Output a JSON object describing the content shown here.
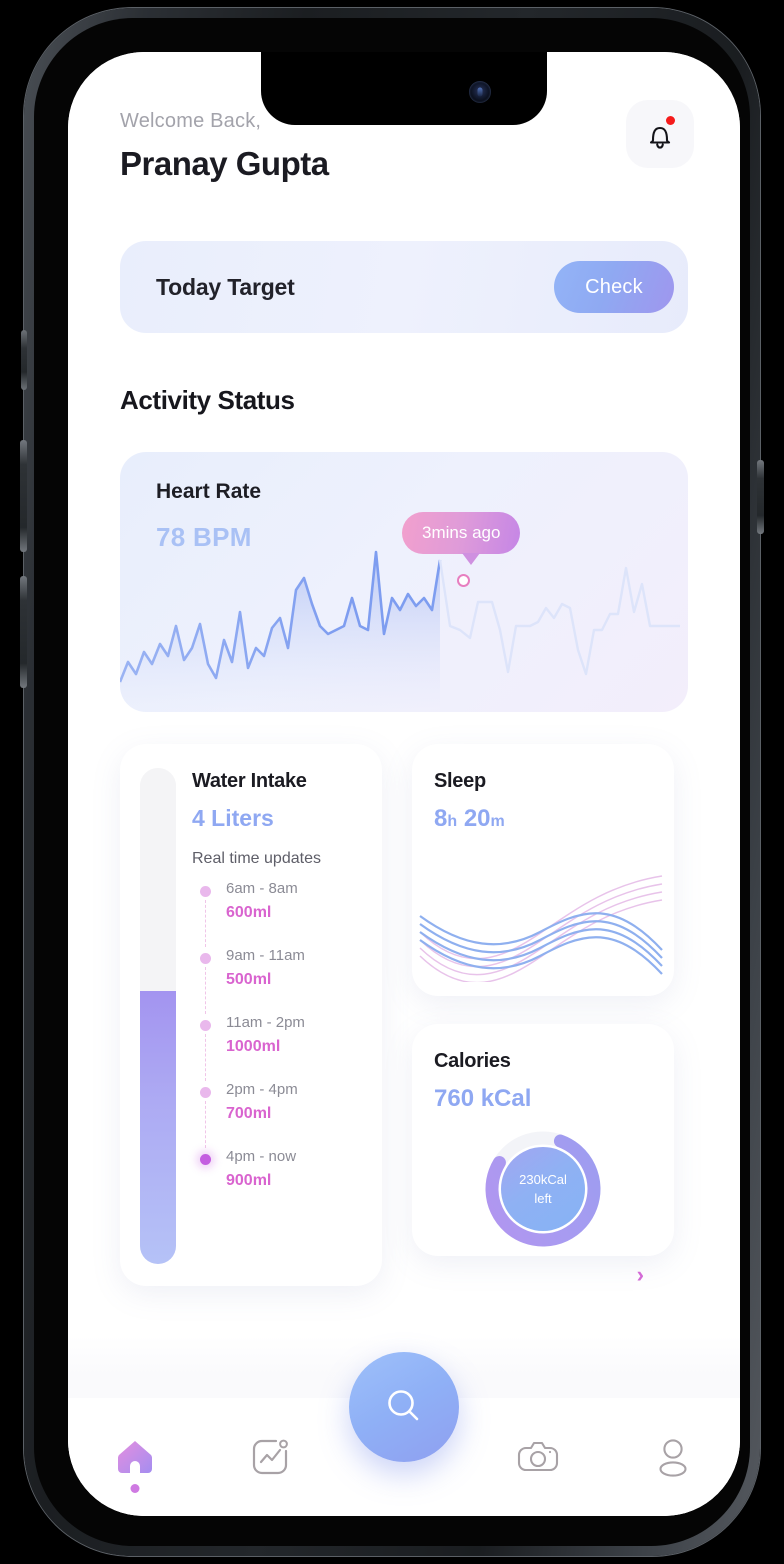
{
  "header": {
    "welcome": "Welcome Back,",
    "username": "Pranay Gupta",
    "bell_icon": "bell-icon"
  },
  "today_target": {
    "label": "Today Target",
    "button": "Check"
  },
  "section": {
    "activity_status": "Activity Status"
  },
  "heart_rate": {
    "title": "Heart Rate",
    "value": "78 BPM",
    "tooltip": "3mins ago"
  },
  "water": {
    "title": "Water Intake",
    "value": "4 Liters",
    "subtitle": "Real time updates",
    "fill_percent": 55,
    "updates": [
      {
        "time": "6am - 8am",
        "amount": "600ml",
        "active": false
      },
      {
        "time": "9am - 11am",
        "amount": "500ml",
        "active": false
      },
      {
        "time": "11am - 2pm",
        "amount": "1000ml",
        "active": false
      },
      {
        "time": "2pm - 4pm",
        "amount": "700ml",
        "active": false
      },
      {
        "time": "4pm - now",
        "amount": "900ml",
        "active": true
      }
    ]
  },
  "sleep": {
    "title": "Sleep",
    "hours": "8",
    "hours_unit": "h",
    "minutes": "20",
    "minutes_unit": "m"
  },
  "calories": {
    "title": "Calories",
    "value": "760 kCal",
    "ring_line1": "230kCal",
    "ring_line2": "left",
    "chevron": "›"
  },
  "tabbar": {
    "items": [
      {
        "name": "home-icon",
        "active": true
      },
      {
        "name": "activity-icon",
        "active": false
      },
      {
        "name": "search-icon",
        "active": false
      },
      {
        "name": "camera-icon",
        "active": false
      },
      {
        "name": "profile-icon",
        "active": false
      }
    ]
  },
  "colors": {
    "accent_blue": "#8fa8f2",
    "accent_purple": "#9f96ee",
    "accent_pink": "#d964cf",
    "text_dark": "#1b1b22",
    "text_muted": "#8b8b95",
    "notification_red": "#f51b1b"
  },
  "chart_data": [
    {
      "type": "line",
      "title": "Heart Rate",
      "ylabel": "BPM",
      "annotation": "3mins ago",
      "marker_index": 40,
      "values": [
        12,
        22,
        8,
        26,
        14,
        30,
        20,
        40,
        18,
        24,
        34,
        12,
        6,
        28,
        18,
        42,
        14,
        26,
        22,
        34,
        38,
        26,
        50,
        60,
        44,
        34,
        30,
        32,
        34,
        46,
        34,
        32,
        72,
        30,
        44,
        38,
        46,
        40,
        44,
        38,
        62,
        40,
        34,
        18,
        38,
        40,
        14,
        34,
        36,
        34,
        18,
        32,
        42,
        38,
        24,
        8,
        30,
        32,
        34,
        46,
        38,
        42,
        58,
        34,
        30,
        36,
        34
      ],
      "solid_until_index": 40
    },
    {
      "type": "line",
      "title": "Sleep",
      "series": [
        {
          "name": "wave-blue-1"
        },
        {
          "name": "wave-blue-2"
        },
        {
          "name": "wave-blue-3"
        },
        {
          "name": "wave-blue-4"
        },
        {
          "name": "wave-pink-1"
        },
        {
          "name": "wave-pink-2"
        },
        {
          "name": "wave-pink-3"
        },
        {
          "name": "wave-pink-4"
        }
      ]
    },
    {
      "type": "pie",
      "title": "Calories",
      "total": 760,
      "remaining": 230,
      "progress_percent": 78,
      "labels": [
        "230kCal",
        "left"
      ]
    },
    {
      "type": "bar",
      "title": "Water Intake",
      "categories": [
        "6am - 8am",
        "9am - 11am",
        "11am - 2pm",
        "2pm - 4pm",
        "4pm - now"
      ],
      "values": [
        600,
        500,
        1000,
        700,
        900
      ],
      "ylabel": "ml",
      "total_liters": 4
    }
  ]
}
